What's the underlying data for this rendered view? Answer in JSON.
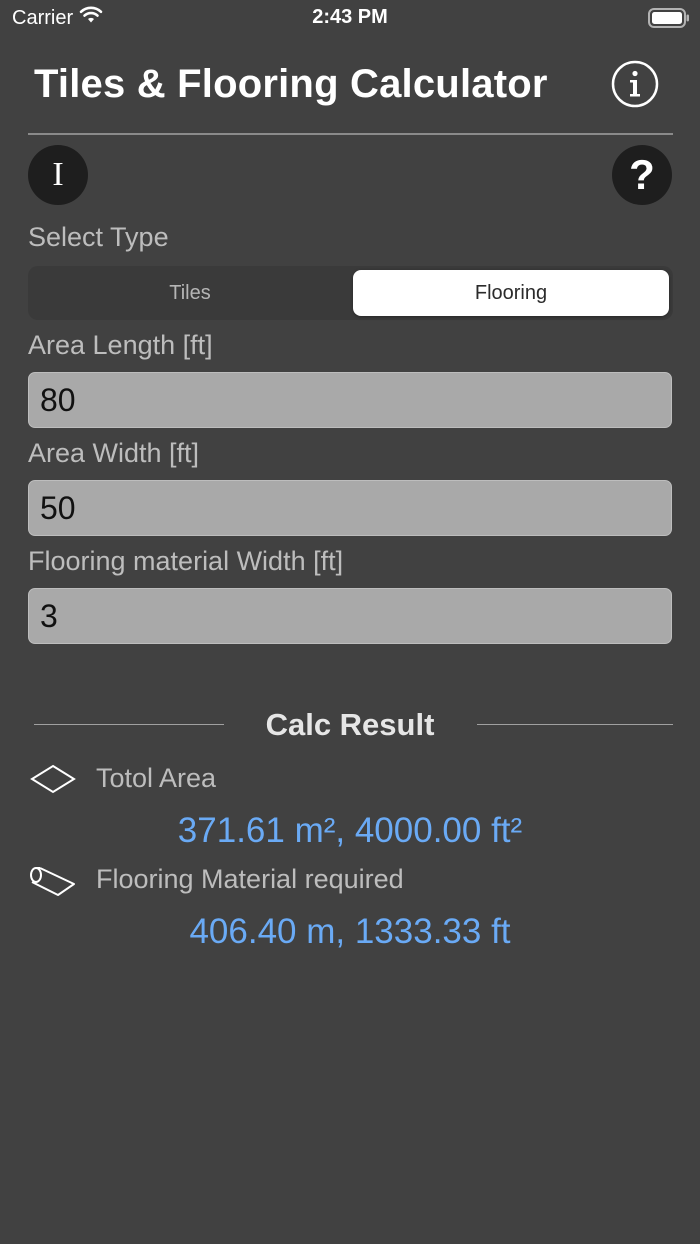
{
  "status_bar": {
    "carrier": "Carrier",
    "time": "2:43 PM",
    "wifi_icon": "wifi-icon",
    "battery_icon": "battery-icon"
  },
  "header": {
    "title": "Tiles & Flooring Calculator",
    "info_icon": "info-circle-icon"
  },
  "toolbar": {
    "cursor_button_glyph": "I",
    "help_button_glyph": "?"
  },
  "type_selector": {
    "label": "Select Type",
    "options": [
      "Tiles",
      "Flooring"
    ],
    "selected": "Flooring"
  },
  "fields": {
    "area_length": {
      "label": "Area Length [ft]",
      "value": "80"
    },
    "area_width": {
      "label": "Area Width [ft]",
      "value": "50"
    },
    "material_width": {
      "label": "Flooring material Width [ft]",
      "value": "3"
    }
  },
  "result": {
    "title": "Calc Result",
    "total_area_label": "Totol Area",
    "total_area_value": "371.61 m², 4000.00 ft²",
    "material_label": "Flooring Material required",
    "material_value": "406.40 m, 1333.33 ft"
  },
  "colors": {
    "background": "#414141",
    "result_value": "#6aaaf5",
    "input_background": "#a9a9a9"
  }
}
